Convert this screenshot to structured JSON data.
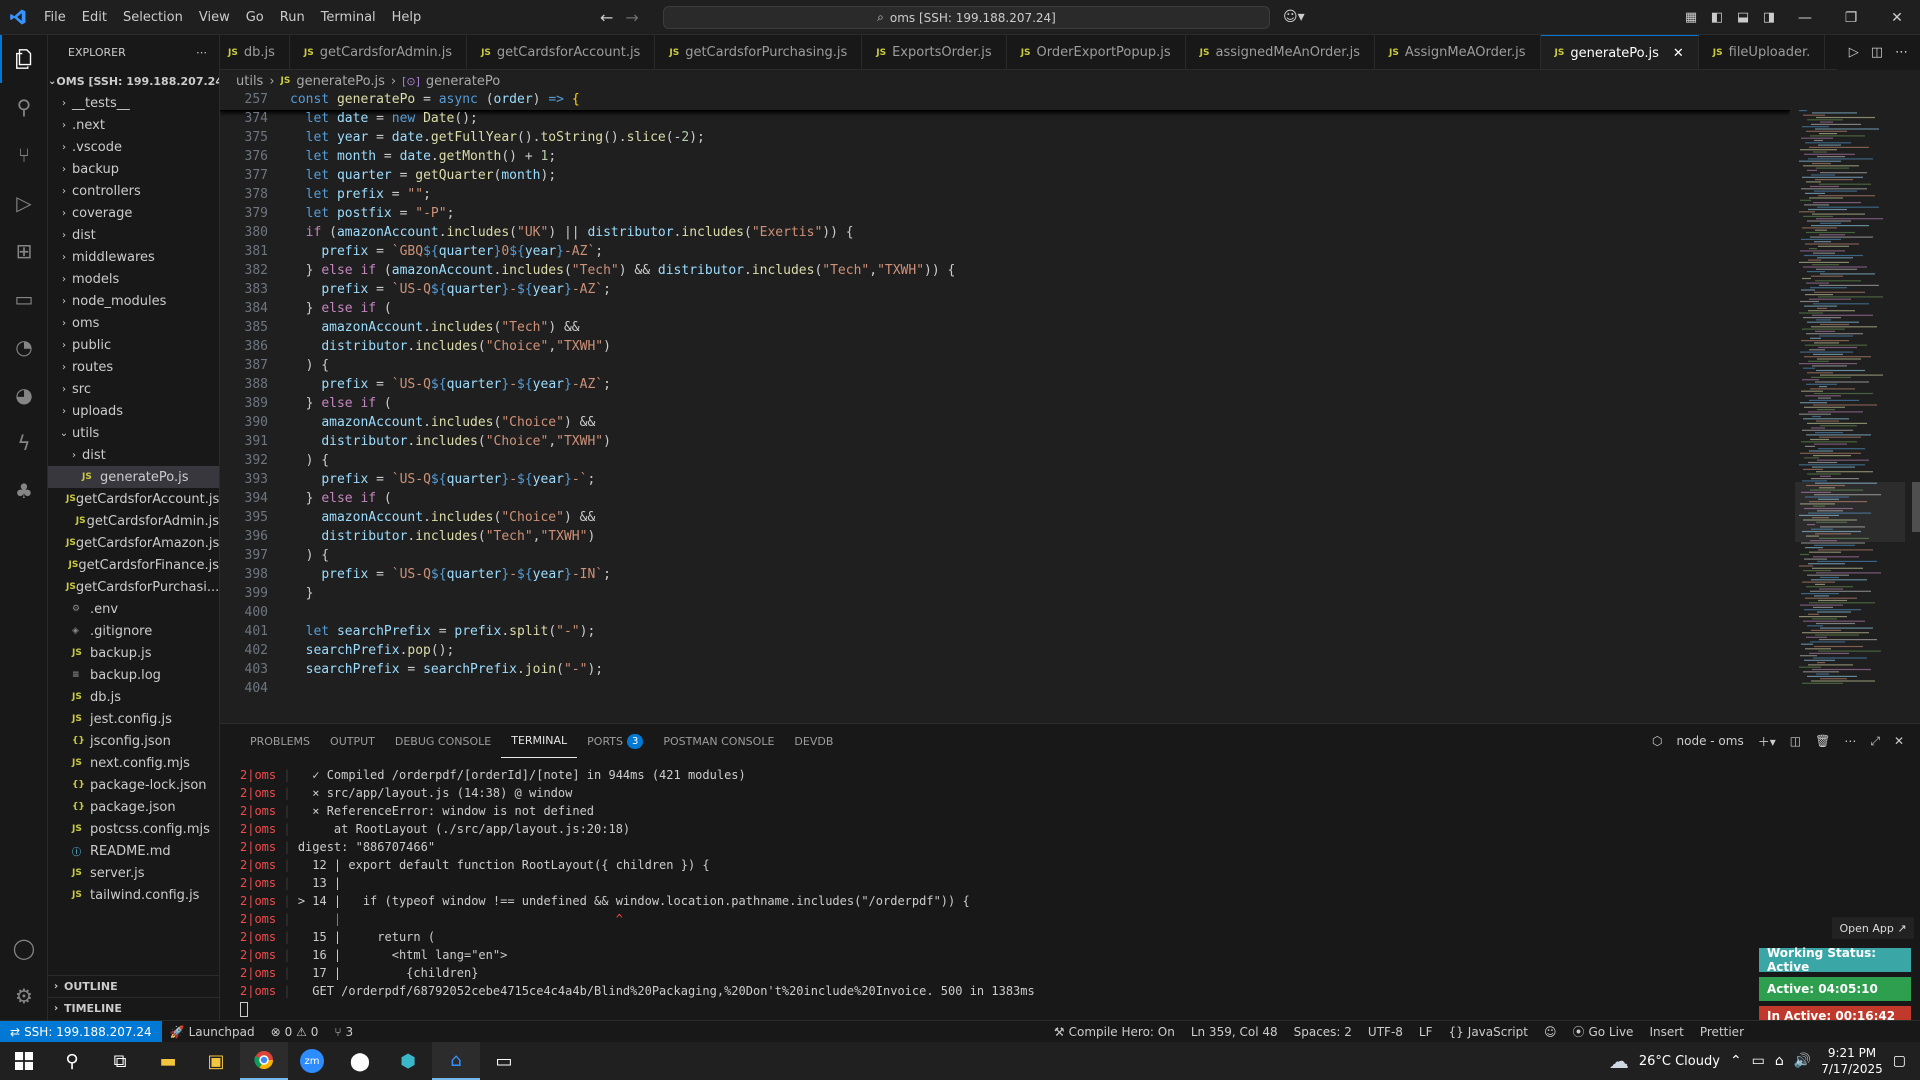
{
  "menu": [
    "File",
    "Edit",
    "Selection",
    "View",
    "Go",
    "Run",
    "Terminal",
    "Help"
  ],
  "command_center": "oms [SSH: 199.188.207.24]",
  "explorer": {
    "title": "EXPLORER",
    "root": "OMS [SSH: 199.188.207.24]",
    "items": [
      {
        "label": "__tests__",
        "kind": "folder",
        "depth": 1
      },
      {
        "label": ".next",
        "kind": "folder",
        "depth": 1
      },
      {
        "label": ".vscode",
        "kind": "folder",
        "depth": 1
      },
      {
        "label": "backup",
        "kind": "folder",
        "depth": 1
      },
      {
        "label": "controllers",
        "kind": "folder",
        "depth": 1
      },
      {
        "label": "coverage",
        "kind": "folder",
        "depth": 1
      },
      {
        "label": "dist",
        "kind": "folder",
        "depth": 1
      },
      {
        "label": "middlewares",
        "kind": "folder",
        "depth": 1
      },
      {
        "label": "models",
        "kind": "folder",
        "depth": 1
      },
      {
        "label": "node_modules",
        "kind": "folder",
        "depth": 1
      },
      {
        "label": "oms",
        "kind": "folder",
        "depth": 1
      },
      {
        "label": "public",
        "kind": "folder",
        "depth": 1
      },
      {
        "label": "routes",
        "kind": "folder",
        "depth": 1
      },
      {
        "label": "src",
        "kind": "folder",
        "depth": 1
      },
      {
        "label": "uploads",
        "kind": "folder",
        "depth": 1
      },
      {
        "label": "utils",
        "kind": "folder-open",
        "depth": 1
      },
      {
        "label": "dist",
        "kind": "folder",
        "depth": 2
      },
      {
        "label": "generatePo.js",
        "kind": "js",
        "depth": 2,
        "selected": true
      },
      {
        "label": "getCardsforAccount.js",
        "kind": "js",
        "depth": 2
      },
      {
        "label": "getCardsforAdmin.js",
        "kind": "js",
        "depth": 2
      },
      {
        "label": "getCardsforAmazon.js",
        "kind": "js",
        "depth": 2
      },
      {
        "label": "getCardsforFinance.js",
        "kind": "js",
        "depth": 2
      },
      {
        "label": "getCardsforPurchasi...",
        "kind": "js",
        "depth": 2
      },
      {
        "label": ".env",
        "kind": "gear",
        "depth": 1
      },
      {
        "label": ".gitignore",
        "kind": "git",
        "depth": 1
      },
      {
        "label": "backup.js",
        "kind": "js",
        "depth": 1
      },
      {
        "label": "backup.log",
        "kind": "log",
        "depth": 1
      },
      {
        "label": "db.js",
        "kind": "js",
        "depth": 1
      },
      {
        "label": "jest.config.js",
        "kind": "js",
        "depth": 1
      },
      {
        "label": "jsconfig.json",
        "kind": "json",
        "depth": 1
      },
      {
        "label": "next.config.mjs",
        "kind": "js",
        "depth": 1
      },
      {
        "label": "package-lock.json",
        "kind": "json",
        "depth": 1
      },
      {
        "label": "package.json",
        "kind": "json",
        "depth": 1
      },
      {
        "label": "postcss.config.mjs",
        "kind": "js",
        "depth": 1
      },
      {
        "label": "README.md",
        "kind": "info",
        "depth": 1
      },
      {
        "label": "server.js",
        "kind": "js",
        "depth": 1
      },
      {
        "label": "tailwind.config.js",
        "kind": "js",
        "depth": 1
      }
    ],
    "outline": "OUTLINE",
    "timeline": "TIMELINE"
  },
  "tabs": [
    {
      "label": "db.js",
      "active": false
    },
    {
      "label": "getCardsforAdmin.js",
      "active": false
    },
    {
      "label": "getCardsforAccount.js",
      "active": false
    },
    {
      "label": "getCardsforPurchasing.js",
      "active": false
    },
    {
      "label": "ExportsOrder.js",
      "active": false
    },
    {
      "label": "OrderExportPopup.js",
      "active": false
    },
    {
      "label": "assignedMeAnOrder.js",
      "active": false
    },
    {
      "label": "AssignMeAOrder.js",
      "active": false
    },
    {
      "label": "generatePo.js",
      "active": true
    },
    {
      "label": "fileUploader.",
      "active": false
    }
  ],
  "breadcrumb": {
    "folder": "utils",
    "file": "generatePo.js",
    "symbol": "generatePo"
  },
  "sticky": {
    "ln": "257",
    "code": "const generatePo = async (order) => {"
  },
  "code_lines": [
    {
      "ln": "374",
      "html": "  <span class='kw'>let</span> <span class='var'>date</span> = <span class='kw'>new</span> <span class='fn'>Date</span>();"
    },
    {
      "ln": "375",
      "html": "  <span class='kw'>let</span> <span class='var'>year</span> = <span class='var'>date</span>.<span class='fn'>getFullYear</span>().<span class='fn'>toString</span>().<span class='fn'>slice</span>(-<span class='num'>2</span>);"
    },
    {
      "ln": "376",
      "html": "  <span class='kw'>let</span> <span class='var'>month</span> = <span class='var'>date</span>.<span class='fn'>getMonth</span>() + <span class='num'>1</span>;"
    },
    {
      "ln": "377",
      "html": "  <span class='kw'>let</span> <span class='var'>quarter</span> = <span class='fn'>getQuarter</span>(<span class='var'>month</span>);"
    },
    {
      "ln": "378",
      "html": "  <span class='kw'>let</span> <span class='var'>prefix</span> = <span class='str'>\"\"</span>;"
    },
    {
      "ln": "379",
      "html": "  <span class='kw'>let</span> <span class='var'>postfix</span> = <span class='str'>\"-P\"</span>;"
    },
    {
      "ln": "380",
      "html": "  <span class='ctl'>if</span> (<span class='var'>amazonAccount</span>.<span class='fn'>includes</span>(<span class='str'>\"UK\"</span>) || <span class='var'>distributor</span>.<span class='fn'>includes</span>(<span class='str'>\"Exertis\"</span>)) {"
    },
    {
      "ln": "381",
      "html": "    <span class='var'>prefix</span> = <span class='str'>`GBQ</span><span class='tpl'>${</span><span class='var'>quarter</span><span class='tpl'>}</span><span class='str'>0</span><span class='tpl'>${</span><span class='var'>year</span><span class='tpl'>}</span><span class='str'>-AZ`</span>;"
    },
    {
      "ln": "382",
      "html": "  } <span class='ctl'>else if</span> (<span class='var'>amazonAccount</span>.<span class='fn'>includes</span>(<span class='str'>\"Tech\"</span>) &amp;&amp; <span class='var'>distributor</span>.<span class='fn'>includes</span>(<span class='str'>\"Tech\"</span>,<span class='str'>\"TXWH\"</span>)) {"
    },
    {
      "ln": "383",
      "html": "    <span class='var'>prefix</span> = <span class='str'>`US-Q</span><span class='tpl'>${</span><span class='var'>quarter</span><span class='tpl'>}</span><span class='str'>-</span><span class='tpl'>${</span><span class='var'>year</span><span class='tpl'>}</span><span class='str'>-AZ`</span>;"
    },
    {
      "ln": "384",
      "html": "  } <span class='ctl'>else if</span> ("
    },
    {
      "ln": "385",
      "html": "    <span class='var'>amazonAccount</span>.<span class='fn'>includes</span>(<span class='str'>\"Tech\"</span>) &amp;&amp;"
    },
    {
      "ln": "386",
      "html": "    <span class='var'>distributor</span>.<span class='fn'>includes</span>(<span class='str'>\"Choice\"</span>,<span class='str'>\"TXWH\"</span>)"
    },
    {
      "ln": "387",
      "html": "  ) {"
    },
    {
      "ln": "388",
      "html": "    <span class='var'>prefix</span> = <span class='str'>`US-Q</span><span class='tpl'>${</span><span class='var'>quarter</span><span class='tpl'>}</span><span class='str'>-</span><span class='tpl'>${</span><span class='var'>year</span><span class='tpl'>}</span><span class='str'>-AZ`</span>;"
    },
    {
      "ln": "389",
      "html": "  } <span class='ctl'>else if</span> ("
    },
    {
      "ln": "390",
      "html": "    <span class='var'>amazonAccount</span>.<span class='fn'>includes</span>(<span class='str'>\"Choice\"</span>) &amp;&amp;"
    },
    {
      "ln": "391",
      "html": "    <span class='var'>distributor</span>.<span class='fn'>includes</span>(<span class='str'>\"Choice\"</span>,<span class='str'>\"TXWH\"</span>)"
    },
    {
      "ln": "392",
      "html": "  ) {"
    },
    {
      "ln": "393",
      "html": "    <span class='var'>prefix</span> = <span class='str'>`US-Q</span><span class='tpl'>${</span><span class='var'>quarter</span><span class='tpl'>}</span><span class='str'>-</span><span class='tpl'>${</span><span class='var'>year</span><span class='tpl'>}</span><span class='str'>-`</span>;"
    },
    {
      "ln": "394",
      "html": "  } <span class='ctl'>else if</span> ("
    },
    {
      "ln": "395",
      "html": "    <span class='var'>amazonAccount</span>.<span class='fn'>includes</span>(<span class='str'>\"Choice\"</span>) &amp;&amp;"
    },
    {
      "ln": "396",
      "html": "    <span class='var'>distributor</span>.<span class='fn'>includes</span>(<span class='str'>\"Tech\"</span>,<span class='str'>\"TXWH\"</span>)"
    },
    {
      "ln": "397",
      "html": "  ) {"
    },
    {
      "ln": "398",
      "html": "    <span class='var'>prefix</span> = <span class='str'>`US-Q</span><span class='tpl'>${</span><span class='var'>quarter</span><span class='tpl'>}</span><span class='str'>-</span><span class='tpl'>${</span><span class='var'>year</span><span class='tpl'>}</span><span class='str'>-IN`</span>;"
    },
    {
      "ln": "399",
      "html": "  }"
    },
    {
      "ln": "400",
      "html": ""
    },
    {
      "ln": "401",
      "html": "  <span class='kw'>let</span> <span class='var'>searchPrefix</span> = <span class='var'>prefix</span>.<span class='fn'>split</span>(<span class='str'>\"-\"</span>);"
    },
    {
      "ln": "402",
      "html": "  <span class='var'>searchPrefix</span>.<span class='fn'>pop</span>();"
    },
    {
      "ln": "403",
      "html": "  <span class='var'>searchPrefix</span> = <span class='var'>searchPrefix</span>.<span class='fn'>join</span>(<span class='str'>\"-\"</span>);"
    },
    {
      "ln": "404",
      "html": ""
    }
  ],
  "panel": {
    "tabs": [
      {
        "label": "PROBLEMS",
        "active": false
      },
      {
        "label": "OUTPUT",
        "active": false
      },
      {
        "label": "DEBUG CONSOLE",
        "active": false
      },
      {
        "label": "TERMINAL",
        "active": true
      },
      {
        "label": "PORTS",
        "active": false,
        "badge": "3"
      },
      {
        "label": "POSTMAN CONSOLE",
        "active": false
      },
      {
        "label": "DEVDB",
        "active": false
      }
    ],
    "terminal_name": "node - oms"
  },
  "terminal_lines": [
    {
      "pre": "2|oms",
      "text": "  ✓ Compiled /orderpdf/[orderId]/[note] in 944ms (421 modules)"
    },
    {
      "pre": "2|oms",
      "text": "  ⨯ src/app/layout.js (14:38) @ window"
    },
    {
      "pre": "2|oms",
      "text": "  ⨯ ReferenceError: window is not defined"
    },
    {
      "pre": "2|oms",
      "text": "     at RootLayout (./src/app/layout.js:20:18)"
    },
    {
      "pre": "2|oms",
      "text": "digest: \"886707466\""
    },
    {
      "pre": "2|oms",
      "text": "  12 | export default function RootLayout({ children }) {"
    },
    {
      "pre": "2|oms",
      "text": "  13 |"
    },
    {
      "pre": "2|oms",
      "text": "> 14 |   if (typeof window !== undefined && window.location.pathname.includes(\"/orderpdf\")) {"
    },
    {
      "pre": "2|oms",
      "text": "     |                                      ^"
    },
    {
      "pre": "2|oms",
      "text": "  15 |     return ("
    },
    {
      "pre": "2|oms",
      "text": "  16 |       <html lang=\"en\">"
    },
    {
      "pre": "2|oms",
      "text": "  17 |         {children}"
    },
    {
      "pre": "2|oms",
      "text": "  GET /orderpdf/68792052cebe4715ce4c4a4b/Blind%20Packaging,%20Don't%20include%20Invoice. 500 in 1383ms"
    }
  ],
  "work_tracker": {
    "open_app": "Open App ↗",
    "status": "Working Status: Active",
    "active": "Active: 04:05:10",
    "inactive": "In Active: 00:16:42",
    "colors": {
      "status": "#3aa6a6",
      "active": "#2e9e4f",
      "inactive": "#c0392b"
    }
  },
  "statusbar": {
    "remote": "SSH: 199.188.207.24",
    "launchpad": "Launchpad",
    "problems": "0 ⚠ 0",
    "ports": "3",
    "compile_hero": "Compile Hero: On",
    "position": "Ln 359, Col 48",
    "spaces": "Spaces: 2",
    "encoding": "UTF-8",
    "eol": "LF",
    "language": "JavaScript",
    "golive": "Go Live",
    "insert": "Insert",
    "prettier": "Prettier"
  },
  "taskbar": {
    "weather": "26°C  Cloudy",
    "time": "9:21 PM",
    "date": "7/17/2025"
  }
}
